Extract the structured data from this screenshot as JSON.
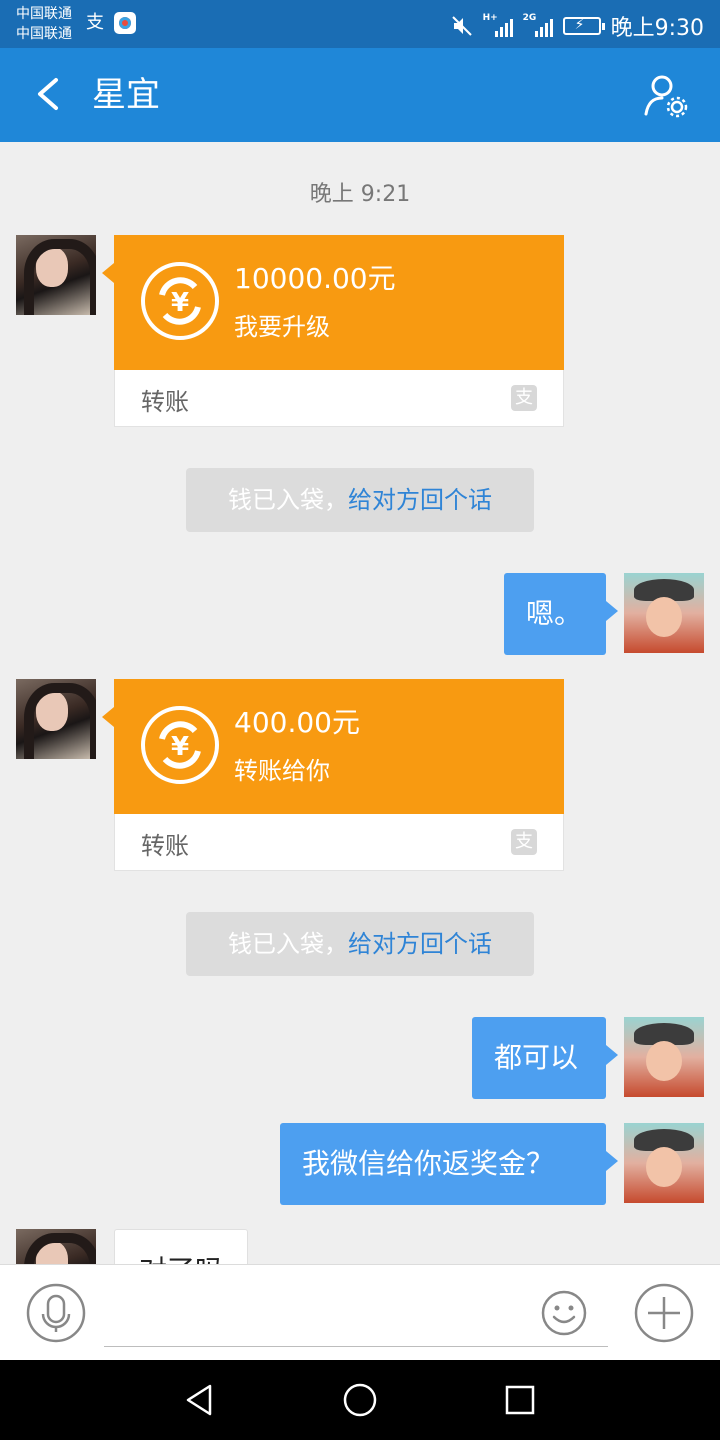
{
  "status_bar": {
    "carrier_1": "中国联通",
    "carrier_2": "中国联通",
    "signal_1_tag": "H+",
    "signal_2_tag": "2G",
    "time": "晚上9:30"
  },
  "header": {
    "title": "星宜"
  },
  "chat": {
    "timestamp": "晚上 9:21",
    "transfer_1": {
      "amount": "10000.00元",
      "memo": "我要升级",
      "label": "转账"
    },
    "system_1": {
      "text": "钱已入袋，",
      "link": "给对方回个话"
    },
    "my_msg_1": "嗯。",
    "transfer_2": {
      "amount": "400.00元",
      "memo": "转账给你",
      "label": "转账"
    },
    "system_2": {
      "text": "钱已入袋，",
      "link": "给对方回个话"
    },
    "my_msg_2": "都可以",
    "my_msg_3": "我微信给你返奖金？",
    "other_msg_partial": "对了吗"
  },
  "input_bar": {
    "placeholder": ""
  },
  "colors": {
    "header": "#1f87d8",
    "status_bar": "#1a6db4",
    "transfer_orange": "#f89a11",
    "my_bubble": "#4d9ff0",
    "link": "#2f84d6"
  },
  "icons": {
    "back": "chevron-left-icon",
    "profile_settings": "person-gear-icon",
    "voice": "microphone-icon",
    "emoji": "smiley-icon",
    "plus": "plus-circle-icon",
    "yen": "yen-transfer-icon",
    "alipay": "alipay-icon"
  }
}
